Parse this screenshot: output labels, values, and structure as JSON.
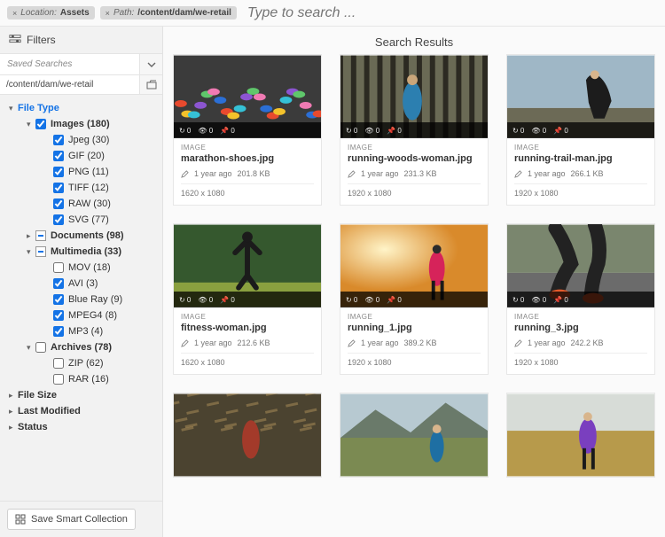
{
  "topbar": {
    "chips": [
      {
        "close": "×",
        "label": "Location:",
        "value": "Assets"
      },
      {
        "close": "×",
        "label": "Path:",
        "value": "/content/dam/we-retail"
      }
    ],
    "search_placeholder": "Type to search ..."
  },
  "sidebar": {
    "header": "Filters",
    "saved_searches_label": "Saved Searches",
    "path_value": "/content/dam/we-retail",
    "tree": [
      {
        "id": "filetype",
        "level": 0,
        "chevron": "▾",
        "label": "File Type",
        "group": true,
        "active": true,
        "checkbox": false
      },
      {
        "id": "images",
        "level": 1,
        "chevron": "▾",
        "label": "Images (180)",
        "group": true,
        "checkbox": true,
        "checked": true
      },
      {
        "id": "jpeg",
        "level": 2,
        "label": "Jpeg (30)",
        "checkbox": true,
        "checked": true
      },
      {
        "id": "gif",
        "level": 2,
        "label": "GIF (20)",
        "checkbox": true,
        "checked": true
      },
      {
        "id": "png",
        "level": 2,
        "label": "PNG (11)",
        "checkbox": true,
        "checked": true
      },
      {
        "id": "tiff",
        "level": 2,
        "label": "TIFF (12)",
        "checkbox": true,
        "checked": true
      },
      {
        "id": "raw",
        "level": 2,
        "label": "RAW (30)",
        "checkbox": true,
        "checked": true
      },
      {
        "id": "svg",
        "level": 2,
        "label": "SVG (77)",
        "checkbox": true,
        "checked": true
      },
      {
        "id": "documents",
        "level": 1,
        "chevron": "▸",
        "label": "Documents (98)",
        "group": true,
        "checkbox": true,
        "mixed": true
      },
      {
        "id": "multimedia",
        "level": 1,
        "chevron": "▾",
        "label": "Multimedia (33)",
        "group": true,
        "checkbox": true,
        "mixed": true
      },
      {
        "id": "mov",
        "level": 2,
        "label": "MOV (18)",
        "checkbox": true,
        "checked": false
      },
      {
        "id": "avi",
        "level": 2,
        "label": "AVI (3)",
        "checkbox": true,
        "checked": true
      },
      {
        "id": "bluray",
        "level": 2,
        "label": "Blue Ray (9)",
        "checkbox": true,
        "checked": true
      },
      {
        "id": "mpeg4",
        "level": 2,
        "label": "MPEG4 (8)",
        "checkbox": true,
        "checked": true
      },
      {
        "id": "mp3",
        "level": 2,
        "label": "MP3 (4)",
        "checkbox": true,
        "checked": true
      },
      {
        "id": "archives",
        "level": 1,
        "chevron": "▾",
        "label": "Archives (78)",
        "group": true,
        "checkbox": true,
        "checked": false
      },
      {
        "id": "zip",
        "level": 2,
        "label": "ZIP (62)",
        "checkbox": true,
        "checked": false
      },
      {
        "id": "rar",
        "level": 2,
        "label": "RAR (16)",
        "checkbox": true,
        "checked": false
      },
      {
        "id": "filesize",
        "level": 0,
        "chevron": "▸",
        "label": "File Size",
        "group": true,
        "checkbox": false
      },
      {
        "id": "lastmodified",
        "level": 0,
        "chevron": "▸",
        "label": "Last Modified",
        "group": true,
        "checkbox": false
      },
      {
        "id": "status",
        "level": 0,
        "chevron": "▸",
        "label": "Status",
        "group": true,
        "checkbox": false
      }
    ],
    "smart_button": "Save Smart Collection"
  },
  "results": {
    "title": "Search Results",
    "overlay_labels": {
      "refresh": "↻ 0",
      "views": "👁 0",
      "pin": "📌 0"
    },
    "kicker": "IMAGE",
    "cards": [
      {
        "file": "marathon-shoes.jpg",
        "age": "1 year ago",
        "size": "201.8 KB",
        "dims": "1620 x 1080",
        "thumb": "marathon"
      },
      {
        "file": "running-woods-woman.jpg",
        "age": "1 year ago",
        "size": "231.3 KB",
        "dims": "1920 x 1080",
        "thumb": "woods"
      },
      {
        "file": "running-trail-man.jpg",
        "age": "1 year ago",
        "size": "266.1 KB",
        "dims": "1920 x 1080",
        "thumb": "trail"
      },
      {
        "file": "fitness-woman.jpg",
        "age": "1 year ago",
        "size": "212.6 KB",
        "dims": "1620 x 1080",
        "thumb": "fitness"
      },
      {
        "file": "running_1.jpg",
        "age": "1 year ago",
        "size": "389.2 KB",
        "dims": "1920 x 1080",
        "thumb": "sunset"
      },
      {
        "file": "running_3.jpg",
        "age": "1 year ago",
        "size": "242.2 KB",
        "dims": "1920 x 1080",
        "thumb": "legs"
      },
      {
        "file": "",
        "age": "",
        "size": "",
        "dims": "",
        "thumb": "blur",
        "partial": true
      },
      {
        "file": "",
        "age": "",
        "size": "",
        "dims": "",
        "thumb": "mountain",
        "partial": true
      },
      {
        "file": "",
        "age": "",
        "size": "",
        "dims": "",
        "thumb": "field",
        "partial": true
      }
    ]
  }
}
